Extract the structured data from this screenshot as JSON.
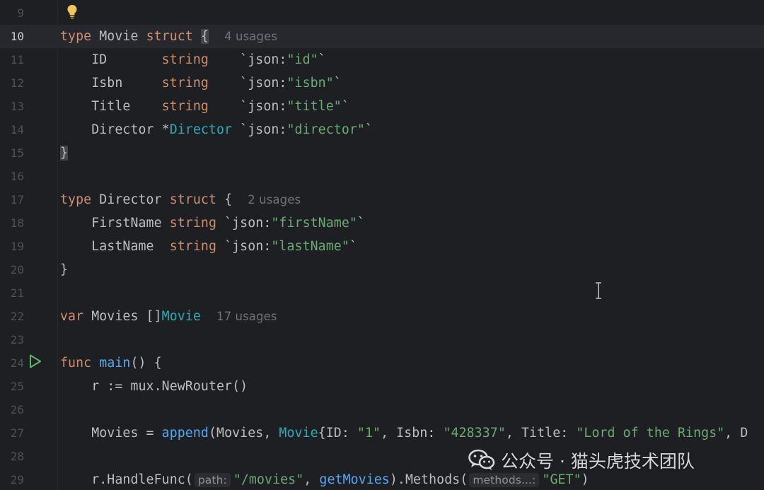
{
  "editor": {
    "current_line": 10,
    "lines": [
      {
        "n": "9",
        "tokens": []
      },
      {
        "n": "10",
        "tokens": [
          {
            "c": "kw",
            "t": "type"
          },
          {
            "c": "txt",
            "t": " Movie "
          },
          {
            "c": "kw",
            "t": "struct"
          },
          {
            "c": "txt",
            "t": " "
          },
          {
            "c": "brace-hl",
            "t": "{"
          },
          {
            "c": "txt",
            "t": "  "
          },
          {
            "c": "hint",
            "t": "4 usages"
          }
        ]
      },
      {
        "n": "11",
        "tokens": [
          {
            "c": "txt",
            "t": "    ID       "
          },
          {
            "c": "kw",
            "t": "string"
          },
          {
            "c": "txt",
            "t": "    `json:"
          },
          {
            "c": "str",
            "t": "\"id\""
          },
          {
            "c": "txt",
            "t": "`"
          }
        ]
      },
      {
        "n": "12",
        "tokens": [
          {
            "c": "txt",
            "t": "    Isbn     "
          },
          {
            "c": "kw",
            "t": "string"
          },
          {
            "c": "txt",
            "t": "    `json:"
          },
          {
            "c": "str",
            "t": "\"isbn\""
          },
          {
            "c": "txt",
            "t": "`"
          }
        ]
      },
      {
        "n": "13",
        "tokens": [
          {
            "c": "txt",
            "t": "    Title    "
          },
          {
            "c": "kw",
            "t": "string"
          },
          {
            "c": "txt",
            "t": "    `json:"
          },
          {
            "c": "str",
            "t": "\"title\""
          },
          {
            "c": "txt",
            "t": "`"
          }
        ]
      },
      {
        "n": "14",
        "tokens": [
          {
            "c": "txt",
            "t": "    Director *"
          },
          {
            "c": "ref",
            "t": "Director"
          },
          {
            "c": "txt",
            "t": " `json:"
          },
          {
            "c": "str",
            "t": "\"director\""
          },
          {
            "c": "txt",
            "t": "`"
          }
        ]
      },
      {
        "n": "15",
        "tokens": [
          {
            "c": "brace-hl",
            "t": "}"
          }
        ]
      },
      {
        "n": "16",
        "tokens": []
      },
      {
        "n": "17",
        "tokens": [
          {
            "c": "kw",
            "t": "type"
          },
          {
            "c": "txt",
            "t": " Director "
          },
          {
            "c": "kw",
            "t": "struct"
          },
          {
            "c": "txt",
            "t": " {  "
          },
          {
            "c": "hint",
            "t": "2 usages"
          }
        ]
      },
      {
        "n": "18",
        "tokens": [
          {
            "c": "txt",
            "t": "    FirstName "
          },
          {
            "c": "kw",
            "t": "string"
          },
          {
            "c": "txt",
            "t": " `json:"
          },
          {
            "c": "str",
            "t": "\"firstName\""
          },
          {
            "c": "txt",
            "t": "`"
          }
        ]
      },
      {
        "n": "19",
        "tokens": [
          {
            "c": "txt",
            "t": "    LastName  "
          },
          {
            "c": "kw",
            "t": "string"
          },
          {
            "c": "txt",
            "t": " `json:"
          },
          {
            "c": "str",
            "t": "\"lastName\""
          },
          {
            "c": "txt",
            "t": "`"
          }
        ]
      },
      {
        "n": "20",
        "tokens": [
          {
            "c": "txt",
            "t": "}"
          }
        ]
      },
      {
        "n": "21",
        "tokens": []
      },
      {
        "n": "22",
        "tokens": [
          {
            "c": "kw",
            "t": "var"
          },
          {
            "c": "txt",
            "t": " Movies []"
          },
          {
            "c": "ref",
            "t": "Movie"
          },
          {
            "c": "txt",
            "t": "  "
          },
          {
            "c": "hint",
            "t": "17 usages"
          }
        ]
      },
      {
        "n": "23",
        "tokens": []
      },
      {
        "n": "24",
        "tokens": [
          {
            "c": "kw",
            "t": "func"
          },
          {
            "c": "txt",
            "t": " "
          },
          {
            "c": "fn",
            "t": "main"
          },
          {
            "c": "txt",
            "t": "() {"
          }
        ]
      },
      {
        "n": "25",
        "tokens": [
          {
            "c": "txt",
            "t": "    r := mux.NewRouter()"
          }
        ]
      },
      {
        "n": "26",
        "tokens": []
      },
      {
        "n": "27",
        "tokens": [
          {
            "c": "txt",
            "t": "    Movies = "
          },
          {
            "c": "fn",
            "t": "append"
          },
          {
            "c": "txt",
            "t": "(Movies, "
          },
          {
            "c": "ref",
            "t": "Movie"
          },
          {
            "c": "txt",
            "t": "{ID: "
          },
          {
            "c": "str",
            "t": "\"1\""
          },
          {
            "c": "txt",
            "t": ", Isbn: "
          },
          {
            "c": "str",
            "t": "\"428337\""
          },
          {
            "c": "txt",
            "t": ", Title: "
          },
          {
            "c": "str",
            "t": "\"Lord of the Rings\""
          },
          {
            "c": "txt",
            "t": ", D"
          }
        ]
      },
      {
        "n": "28",
        "tokens": []
      },
      {
        "n": "29",
        "tokens": [
          {
            "c": "txt",
            "t": "    r.HandleFunc("
          },
          {
            "c": "param-hint",
            "t": "path:"
          },
          {
            "c": "str",
            "t": "\"/movies\""
          },
          {
            "c": "txt",
            "t": ", "
          },
          {
            "c": "fn",
            "t": "getMovies"
          },
          {
            "c": "txt",
            "t": ").Methods("
          },
          {
            "c": "param-hint",
            "t": "methods...:"
          },
          {
            "c": "str",
            "t": "\"GET\""
          },
          {
            "c": "txt",
            "t": ")"
          }
        ]
      }
    ]
  },
  "watermark": {
    "text": "公众号 · 猫头虎技术团队",
    "icon": "wechat-icon"
  },
  "icons": {
    "intention": "bulb-icon",
    "run": "run-icon",
    "cursor": "text-cursor-icon"
  },
  "colors": {
    "background": "#1e1f22",
    "keyword": "#cf8e6d",
    "string": "#6aab73",
    "type_ref": "#2aacb8",
    "function": "#56a8f5",
    "text": "#bcbec4",
    "hint": "#6f737a",
    "run_green": "#5fb865",
    "bulb_yellow": "#f2c55c"
  }
}
